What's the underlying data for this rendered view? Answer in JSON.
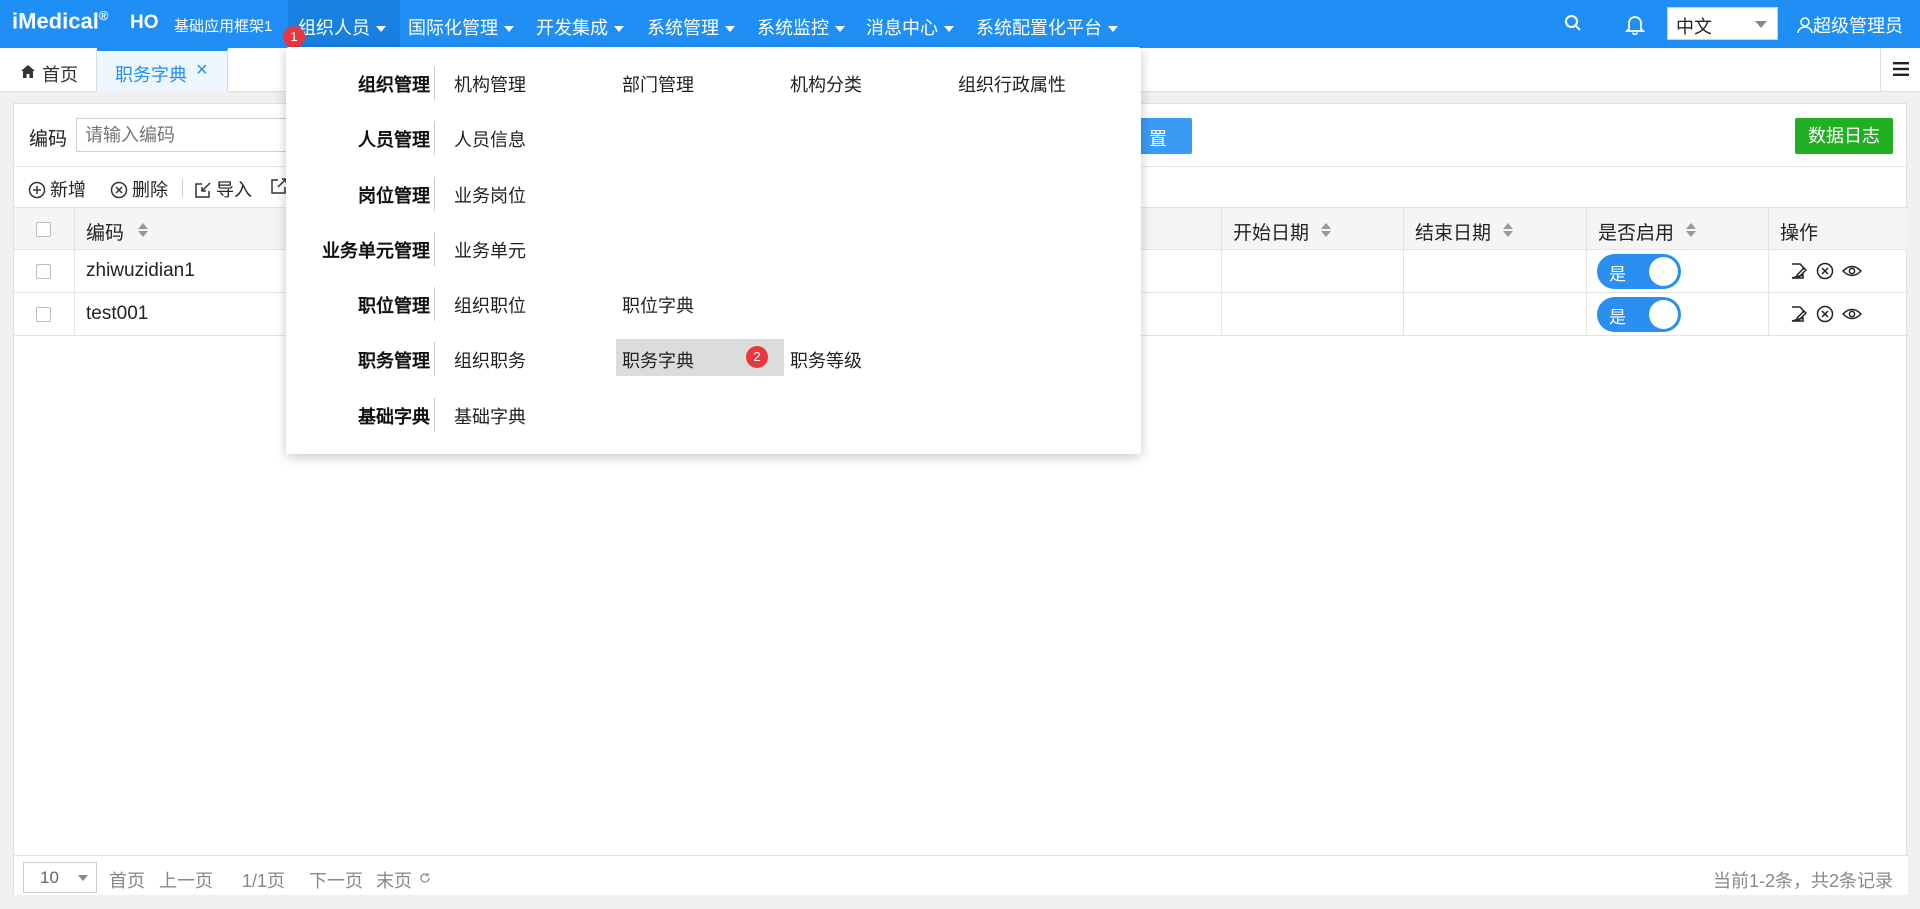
{
  "app": {
    "logo": "iMedical",
    "logo_mark": "®",
    "logo_suffix": "HO",
    "subtitle": "基础应用框架1"
  },
  "nav": {
    "items": [
      {
        "label": "组织人员"
      },
      {
        "label": "国际化管理"
      },
      {
        "label": "开发集成"
      },
      {
        "label": "系统管理"
      },
      {
        "label": "系统监控"
      },
      {
        "label": "消息中心"
      },
      {
        "label": "系统配置化平台"
      }
    ],
    "badge_1": "1",
    "badge_2": "2"
  },
  "header": {
    "language": "中文",
    "user": "超级管理员"
  },
  "tabs": {
    "home": "首页",
    "active": "职务字典",
    "close": "×"
  },
  "search": {
    "label": "编码",
    "placeholder": "请输入编码",
    "reset_partial": "置",
    "log_button": "数据日志"
  },
  "toolbar": {
    "add": "新增",
    "delete": "删除",
    "import": "导入"
  },
  "table": {
    "headers": {
      "code": "编码",
      "start_date": "开始日期",
      "end_date": "结束日期",
      "enabled": "是否启用",
      "actions": "操作"
    },
    "rows": [
      {
        "code": "zhiwuzidian1",
        "enabled": "是"
      },
      {
        "code": "test001",
        "enabled": "是"
      }
    ]
  },
  "pagination": {
    "page_size": "10",
    "first": "首页",
    "prev": "上一页",
    "page": "1/1页",
    "next": "下一页",
    "last": "末页",
    "summary": "当前1-2条，共2条记录"
  },
  "mega_menu": {
    "rows": [
      {
        "category": "组织管理",
        "links": [
          "机构管理",
          "部门管理",
          "机构分类",
          "组织行政属性"
        ]
      },
      {
        "category": "人员管理",
        "links": [
          "人员信息"
        ]
      },
      {
        "category": "岗位管理",
        "links": [
          "业务岗位"
        ]
      },
      {
        "category": "业务单元管理",
        "links": [
          "业务单元"
        ]
      },
      {
        "category": "职位管理",
        "links": [
          "组织职位",
          "职位字典"
        ]
      },
      {
        "category": "职务管理",
        "links": [
          "组织职务",
          "职务字典",
          "职务等级"
        ]
      },
      {
        "category": "基础字典",
        "links": [
          "基础字典"
        ]
      }
    ]
  },
  "colors": {
    "topbar": "#1f8ff5",
    "accent": "#1f8ff5",
    "log_button": "#20b022",
    "badge": "#e8373d"
  }
}
